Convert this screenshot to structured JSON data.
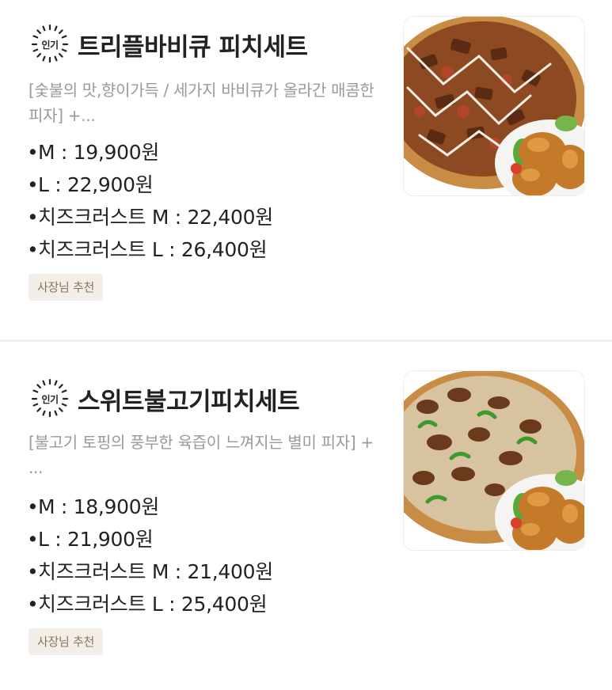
{
  "items": [
    {
      "badge": "인기",
      "title": "트리플바비큐 피치세트",
      "description": "[숯불의 맛,향이가득 / 세가지 바비큐가 올라간 매콤한 피자] +...",
      "prices": [
        {
          "bullet": "•",
          "text": "M : 19,900원"
        },
        {
          "bullet": "•",
          "text": "L : 22,900원"
        },
        {
          "bullet": "•",
          "text": "치즈크러스트 M : 22,400원"
        },
        {
          "bullet": "•",
          "text": "치즈크러스트 L : 26,400원"
        }
      ],
      "tag": "사장님 추천",
      "image_icon": "pizza-chicken-photo"
    },
    {
      "badge": "인기",
      "title": "스위트불고기피치세트",
      "description": "[불고기 토핑의 풍부한 육즙이 느껴지는 별미 피자] + ...",
      "prices": [
        {
          "bullet": "•",
          "text": "M : 18,900원"
        },
        {
          "bullet": "•",
          "text": "L : 21,900원"
        },
        {
          "bullet": "•",
          "text": "치즈크러스트 M : 21,400원"
        },
        {
          "bullet": "•",
          "text": "치즈크러스트 L : 25,400원"
        }
      ],
      "tag": "사장님 추천",
      "image_icon": "pizza-chicken-photo"
    }
  ],
  "colors": {
    "title": "#222222",
    "description": "#9a9a9a",
    "tag_bg": "#f3eee7",
    "tag_text": "#8a7660",
    "divider": "#f1f1f1"
  }
}
